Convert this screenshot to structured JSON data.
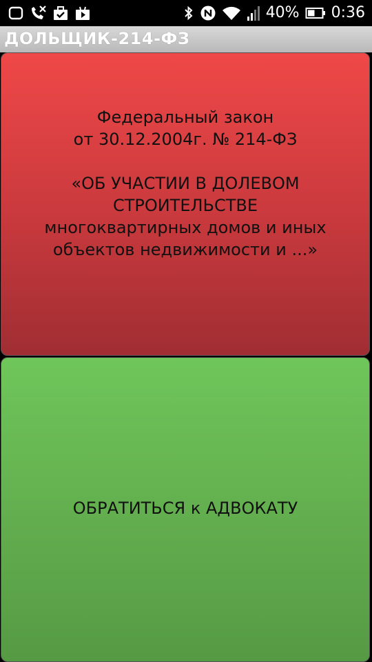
{
  "status_bar": {
    "icons_left": [
      "screen-icon",
      "missed-call-icon",
      "briefcase-check-icon",
      "play-store-icon"
    ],
    "icons_right": [
      "bluetooth-icon",
      "nfc-icon",
      "wifi-icon",
      "signal-icon"
    ],
    "battery_percent": "40%",
    "time": "0:36"
  },
  "app_bar": {
    "title": "ДОЛЬЩИК-214-ФЗ"
  },
  "law_panel": {
    "line1": "Федеральный закон",
    "line2": "от 30.12.2004г. № 214-ФЗ",
    "line3": "«ОБ УЧАСТИИ В ДОЛЕВОМ",
    "line4": "СТРОИТЕЛЬСТВЕ",
    "line5": "многоквартирных домов и иных",
    "line6": "объектов недвижимости и ...»",
    "color": "#e0403f"
  },
  "lawyer_panel": {
    "label": "ОБРАТИТЬСЯ к АДВОКАТУ",
    "color": "#66b553"
  }
}
